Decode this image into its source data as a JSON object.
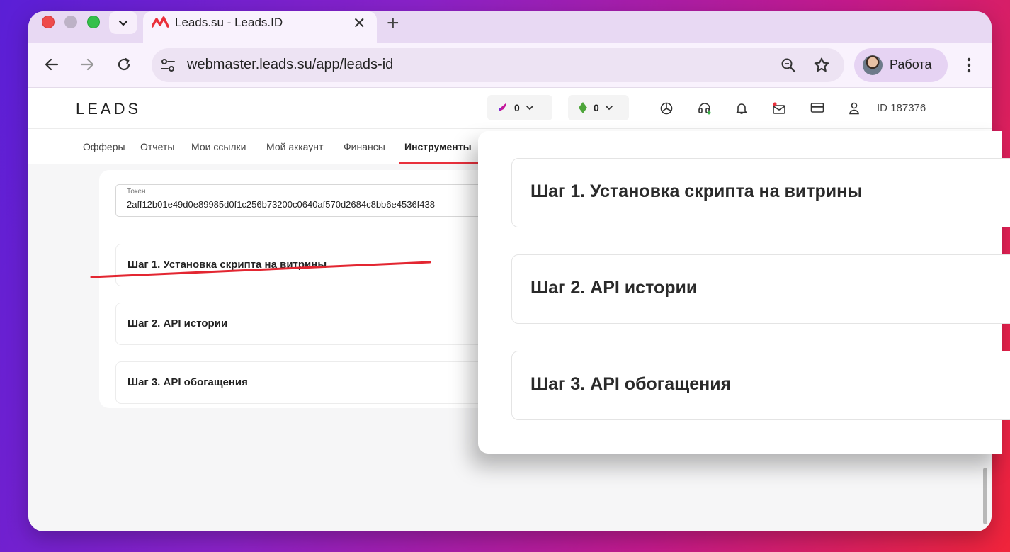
{
  "browser": {
    "tab_title": "Leads.su - Leads.ID",
    "url": "webmaster.leads.su/app/leads-id",
    "profile_label": "Работа"
  },
  "header": {
    "brand": "LEADS",
    "balance_a": "0",
    "balance_b": "0",
    "user_id": "ID 187376"
  },
  "nav": {
    "items": [
      "Офферы",
      "Отчеты",
      "Мои ссылки",
      "Мой аккаунт",
      "Финансы",
      "Инструменты"
    ],
    "active": "Инструменты"
  },
  "main": {
    "token_label": "Токен",
    "token_value": "2aff12b01e49d0e89985d0f1c256b73200c0640af570d2684c8bb6e4536f438",
    "steps": [
      "Шаг 1. Установка скрипта на витрины",
      "Шаг 2. API истории",
      "Шаг 3. API обогащения"
    ]
  },
  "zoom": {
    "steps": [
      "Шаг 1. Установка скрипта на витрины",
      "Шаг 2. API истории",
      "Шаг 3. API обогащения"
    ]
  },
  "colors": {
    "accent": "#e8303c",
    "background_gradient_start": "#5a1fd6",
    "background_gradient_end": "#f0243a"
  }
}
